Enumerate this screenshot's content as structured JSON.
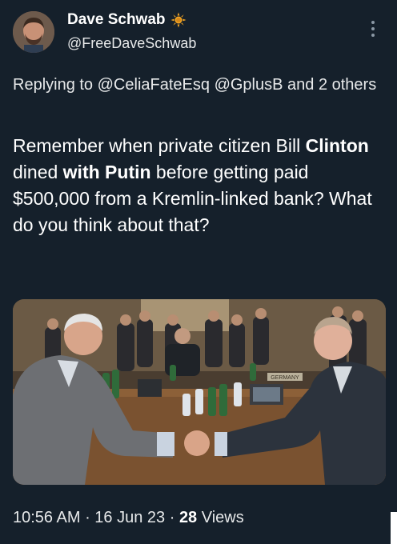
{
  "tweet": {
    "author": {
      "display_name": "Dave Schwab",
      "handle": "@FreeDaveSchwab",
      "badge_icon": "sun-icon",
      "avatar": "avatar-photo"
    },
    "reply": {
      "prefix": "Replying to ",
      "mentions": [
        "@CeliaFateEsq",
        "@GplusB"
      ],
      "conjunction": " and ",
      "others": "2 others"
    },
    "text": {
      "part1": "Remember when private citizen Bill ",
      "bold1": "Clinton",
      "part2": " dined ",
      "bold2": "with Putin",
      "part3": " before getting paid $500,000 from a Kremlin-linked bank? What do you think about that?"
    },
    "photo_sign": "GERMANY",
    "timestamp": {
      "time": "10:56 AM",
      "separator": " · ",
      "date": "16 Jun 23",
      "views_count": "28",
      "views_label": " Views"
    }
  },
  "colors": {
    "background": "#15202b",
    "text": "#ffffff",
    "secondary": "#8b98a5"
  }
}
